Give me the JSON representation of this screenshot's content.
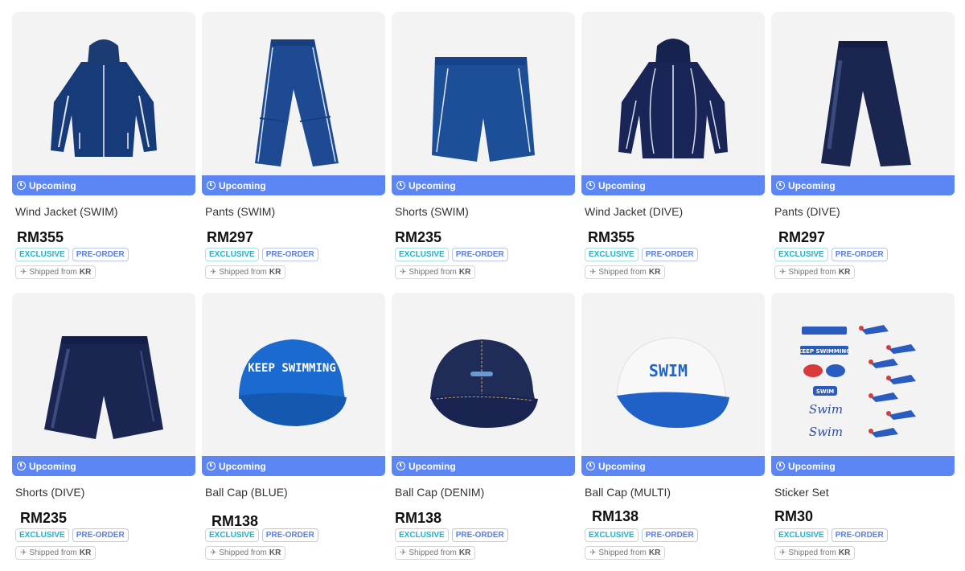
{
  "status_label": "Upcoming",
  "tag_exclusive": "EXCLUSIVE",
  "tag_preorder": "PRE-ORDER",
  "shipped_label": "Shipped from",
  "shipped_origin": "KR",
  "colors": {
    "status_bar": "#5b86f3",
    "exclusive": "#19b6c9",
    "preorder": "#5b7ee6"
  },
  "products": [
    {
      "name": "Wind Jacket (SWIM)",
      "price": "RM355",
      "image": "jacket-swim"
    },
    {
      "name": "Pants (SWIM)",
      "price": "RM297",
      "image": "pants-swim"
    },
    {
      "name": "Shorts (SWIM)",
      "price": "RM235",
      "image": "shorts-swim"
    },
    {
      "name": "Wind Jacket (DIVE)",
      "price": "RM355",
      "image": "jacket-dive"
    },
    {
      "name": "Pants (DIVE)",
      "price": "RM297",
      "image": "pants-dive"
    },
    {
      "name": "Shorts (DIVE)",
      "price": "RM235",
      "image": "shorts-dive"
    },
    {
      "name": "Ball Cap (BLUE)",
      "price": "RM138",
      "image": "cap-blue",
      "image_text": "KEEP SWIMMING"
    },
    {
      "name": "Ball Cap (DENIM)",
      "price": "RM138",
      "image": "cap-denim"
    },
    {
      "name": "Ball Cap (MULTI)",
      "price": "RM138",
      "image": "cap-multi",
      "image_text": "SWIM"
    },
    {
      "name": "Sticker Set",
      "price": "RM30",
      "image": "sticker-set",
      "image_text": [
        "KEEP SWIMMING",
        "SWIM",
        "Swim",
        "Swim"
      ]
    }
  ]
}
